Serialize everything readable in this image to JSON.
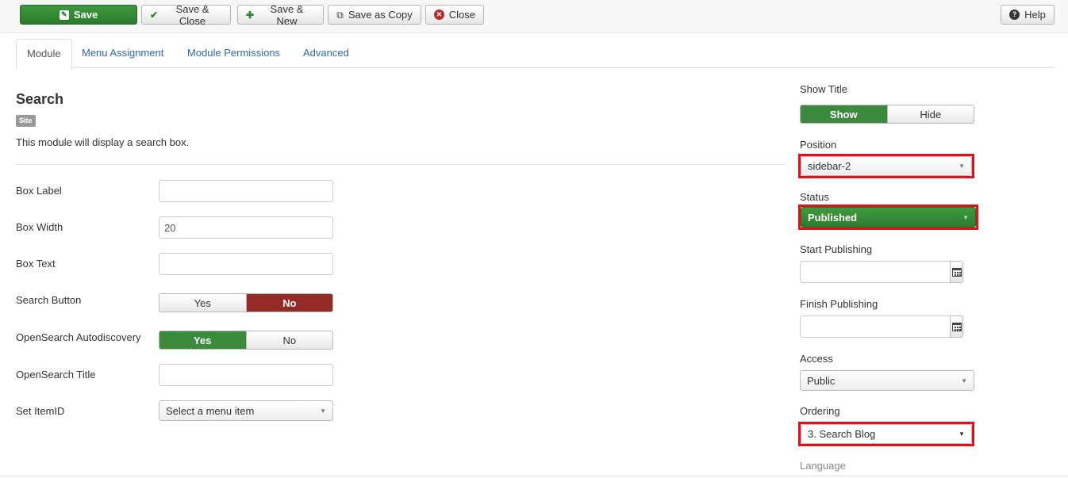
{
  "toolbar": {
    "save_label": "Save",
    "save_close_label": "Save & Close",
    "save_new_label": "Save & New",
    "save_copy_label": "Save as Copy",
    "close_label": "Close",
    "help_label": "Help",
    "icons": {
      "save": "save-icon",
      "save_close": "check-icon",
      "save_new": "plus-icon",
      "save_copy": "copy-icon",
      "close": "close-circle-icon",
      "help": "question-circle-icon"
    }
  },
  "tabs": [
    {
      "label": "Module",
      "active": true
    },
    {
      "label": "Menu Assignment",
      "active": false
    },
    {
      "label": "Module Permissions",
      "active": false
    },
    {
      "label": "Advanced",
      "active": false
    }
  ],
  "module": {
    "title": "Search",
    "badge": "Site",
    "description": "This module will display a search box."
  },
  "fields": {
    "box_label": {
      "label": "Box Label",
      "value": ""
    },
    "box_width": {
      "label": "Box Width",
      "value": "20"
    },
    "box_text": {
      "label": "Box Text",
      "value": ""
    },
    "search_button": {
      "label": "Search Button",
      "yes": "Yes",
      "no": "No",
      "selected": "No"
    },
    "opensearch_autodiscovery": {
      "label": "OpenSearch Autodiscovery",
      "yes": "Yes",
      "no": "No",
      "selected": "Yes"
    },
    "opensearch_title": {
      "label": "OpenSearch Title",
      "value": ""
    },
    "set_itemid": {
      "label": "Set ItemID",
      "value": "Select a menu item"
    }
  },
  "sidebar": {
    "show_title": {
      "label": "Show Title",
      "show": "Show",
      "hide": "Hide",
      "selected": "Show"
    },
    "position": {
      "label": "Position",
      "value": "sidebar-2"
    },
    "status": {
      "label": "Status",
      "value": "Published"
    },
    "start_publishing": {
      "label": "Start Publishing",
      "value": ""
    },
    "finish_publishing": {
      "label": "Finish Publishing",
      "value": ""
    },
    "access": {
      "label": "Access",
      "value": "Public"
    },
    "ordering": {
      "label": "Ordering",
      "value": "3. Search Blog"
    },
    "language": {
      "label": "Language"
    }
  },
  "colors": {
    "save_green": "#2b7a2b",
    "toggle_red": "#942a25",
    "toggle_green": "#3c8a3c",
    "highlight_red": "#e2101b",
    "link_blue": "#2a69b8"
  }
}
